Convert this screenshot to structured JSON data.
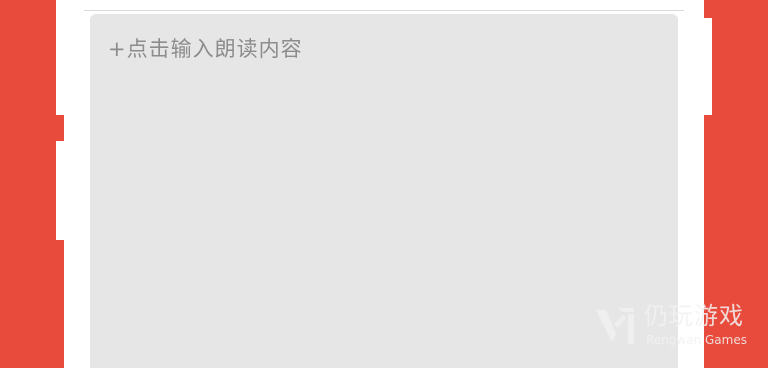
{
  "editor": {
    "placeholder": "+点击输入朗读内容"
  },
  "watermark": {
    "title": "仍玩游戏",
    "subtitle": "Rengwan Games",
    "icon": "rengwan-logo-icon"
  },
  "colors": {
    "background": "#e84a3c",
    "frame": "#ffffff",
    "text_area": "#e6e6e6",
    "placeholder_text": "#8c8c8c"
  }
}
